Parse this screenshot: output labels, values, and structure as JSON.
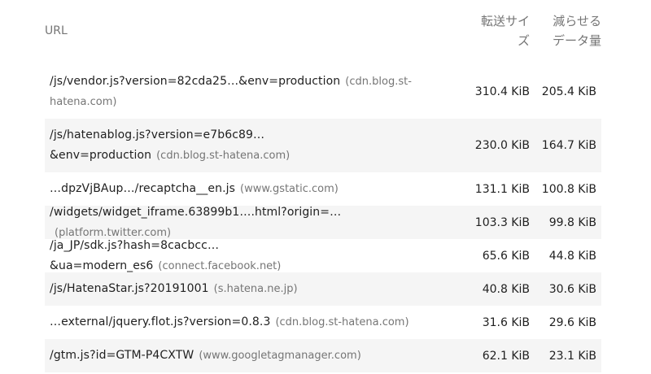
{
  "header": {
    "url_label": "URL",
    "size_label_line1": "転送サイ",
    "size_label_line2": "ズ",
    "savings_label_line1": "減らせる",
    "savings_label_line2": "データ量"
  },
  "rows": [
    {
      "path": "/js/vendor.js?version=82cda25…&env=production",
      "host": "(cdn.blog.st-hatena.com)",
      "size": "310.4 KiB",
      "savings": "205.4 KiB"
    },
    {
      "path": "/js/hatenablog.js?version=e7b6c89…&env=production",
      "host": "(cdn.blog.st-hatena.com)",
      "size": "230.0 KiB",
      "savings": "164.7 KiB"
    },
    {
      "path": "…dpzVjBAup…/recaptcha__en.js",
      "host": "(www.gstatic.com)",
      "size": "131.1 KiB",
      "savings": "100.8 KiB"
    },
    {
      "path": "/widgets/widget_iframe.63899b1….html?origin=…",
      "host": "(platform.twitter.com)",
      "size": "103.3 KiB",
      "savings": "99.8 KiB"
    },
    {
      "path": "/ja_JP/sdk.js?hash=8cacbcc…&ua=modern_es6",
      "host": "(connect.facebook.net)",
      "size": "65.6 KiB",
      "savings": "44.8 KiB"
    },
    {
      "path": "/js/HatenaStar.js?20191001",
      "host": "(s.hatena.ne.jp)",
      "size": "40.8 KiB",
      "savings": "30.6 KiB"
    },
    {
      "path": "…external/jquery.flot.js?version=0.8.3",
      "host": "(cdn.blog.st-hatena.com)",
      "size": "31.6 KiB",
      "savings": "29.6 KiB"
    },
    {
      "path": "/gtm.js?id=GTM-P4CXTW",
      "host": "(www.googletagmanager.com)",
      "size": "62.1 KiB",
      "savings": "23.1 KiB"
    }
  ]
}
